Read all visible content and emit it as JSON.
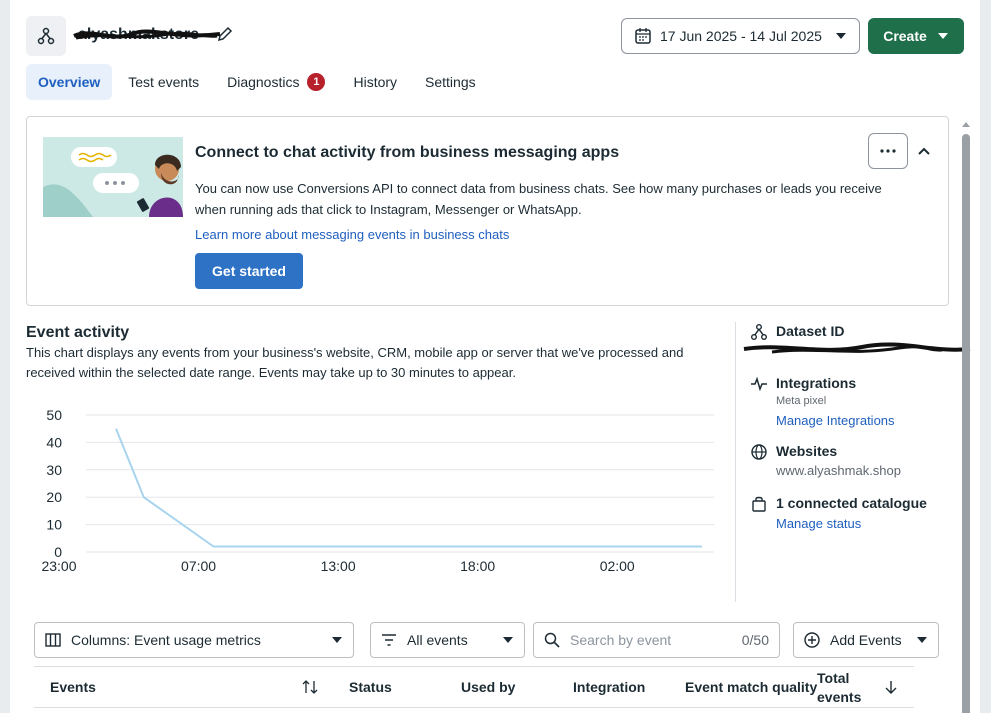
{
  "header": {
    "dataset_name": "alyashmakstore",
    "date_range": "17 Jun 2025 - 14 Jul 2025",
    "create_label": "Create"
  },
  "tabs": [
    {
      "label": "Overview",
      "active": true
    },
    {
      "label": "Test events"
    },
    {
      "label": "Diagnostics",
      "badge": "1"
    },
    {
      "label": "History"
    },
    {
      "label": "Settings"
    }
  ],
  "banner": {
    "title": "Connect to chat activity from business messaging apps",
    "description": "You can now use Conversions API to connect data from business chats. See how many purchases or leads you receive when running ads that click to Instagram, Messenger or WhatsApp.",
    "link": "Learn more about messaging events in business chats",
    "button": "Get started"
  },
  "event_activity": {
    "title": "Event activity",
    "description": "This chart displays any events from your business's website, CRM, mobile app or server that we've processed and received within the selected date range. Events may take up to 30 minutes to appear."
  },
  "chart_data": {
    "type": "line",
    "x": [
      "23:00",
      "",
      "07:00",
      "",
      "13:00",
      "",
      "18:00",
      "",
      "02:00",
      ""
    ],
    "xticks": [
      "23:00",
      "07:00",
      "13:00",
      "18:00",
      "02:00"
    ],
    "series": [
      {
        "values": [
          45,
          20,
          2,
          2,
          2,
          2,
          2,
          2,
          2,
          2
        ],
        "color": "#a8d4ee"
      }
    ],
    "ylim": [
      0,
      50
    ],
    "yticks": [
      0,
      10,
      20,
      30,
      40,
      50
    ],
    "grid": true
  },
  "side_panel": {
    "dataset_id_title": "Dataset ID",
    "integrations_title": "Integrations",
    "integrations_sub": "Meta pixel",
    "integrations_link": "Manage Integrations",
    "websites_title": "Websites",
    "websites_value": "www.alyashmak.shop",
    "catalogue_title": "1 connected catalogue",
    "catalogue_link": "Manage status"
  },
  "filters": {
    "columns": "Columns: Event usage metrics",
    "events": "All events",
    "search_placeholder": "Search by event",
    "search_count": "0/50",
    "add_events": "Add Events"
  },
  "table": {
    "headers": [
      "Events",
      "Status",
      "Used by",
      "Integration",
      "Event match quality",
      "Total events"
    ]
  },
  "colors": {
    "accent": "#1f6f4a",
    "link": "#1f5fbf",
    "primary_button": "#2e72c5",
    "badge": "#b8202c"
  }
}
